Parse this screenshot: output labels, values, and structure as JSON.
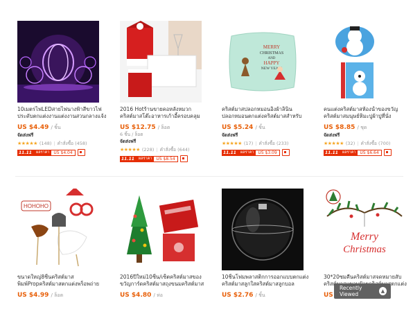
{
  "products": [
    {
      "title": "10เมตรไฟLEDสายไฟนางฟ้าสีขาวไฟประดับตกแต่งงานแต่งงานสวนกลางแจ้งคริสต์มาส สำหรับสวนไฟคริสต์มาสตกแต่งPTSP",
      "price": "US $4.49",
      "unit": "/ ชิ้น",
      "shipping": "จัดส่งฟรี",
      "reviews": "(148)",
      "orders": "คำสั่งซื้อ (458)",
      "promo_label": "ผลราคา",
      "promo_price": "US $4.04"
    },
    {
      "title": "2016 Hotร้านขายคอหลังหมวกคริสต์มาสโต๊ะอาหารเก้าอี้ครอบคลุมตกแต่งคริสต์มาส",
      "price": "US $12.75",
      "unit": "/ ล็อต",
      "sub": "6 ชิ้น / ล็อต",
      "shipping": "จัดส่งฟรี",
      "reviews": "(228)",
      "orders": "คำสั่งซื้อ (644)",
      "promo_label": "ผลราคา",
      "promo_price": "US $8.54"
    },
    {
      "title": "คริสต์มาสปลอกหมอนอิงผ้าลินินปลอกหมอนตกแต่งคริสต์มาสสำหรับโซฟา",
      "price": "US $5.24",
      "unit": "/ ชิ้น",
      "shipping": "จัดส่งฟรี",
      "reviews": "(17)",
      "orders": "คำสั่งซื้อ (233)",
      "promo_label": "ผลราคา",
      "promo_price": "US $3.09"
    },
    {
      "title": "คนแต่งคริสต์มาสห้องน้ำของขวัญคริสต์มาสมนุษย์หิมะปูผ้าปูที่นั่ง",
      "price": "US $8.85",
      "unit": "/ ชุด",
      "shipping": "จัดส่งฟรี",
      "reviews": "(32)",
      "orders": "คำสั่งซื้อ (700)",
      "promo_label": "ผลราคา",
      "promo_price": "US $6.64"
    },
    {
      "title": "ขนาดใหญ่8ชิ้นคริสต์มาสพิมพ์Propคริสต์มาสตกแต่งพร็อพถ่ายภาพสนุกสำหรับของขวัญ",
      "price": "US $4.99",
      "unit": "/ ล็อต"
    },
    {
      "title": "2016ปีใหม่10ชิ้น/เซ็ตคริสต์มาสของขวัญการ์ดคริสต์มาสถุงขนมคริสต์มาส",
      "price": "US $4.80",
      "unit": "/ ห่อ"
    },
    {
      "title": "10ชิ้นโฟมพลาสติกการออกแบบตกแต่งคริสต์มาสลูกใสคริสต์มาสลูกบอลพลาสติก",
      "price": "US $2.76",
      "unit": "/ ชิ้น"
    },
    {
      "title": "30*20ซมคืนคริสต์มาสจดหมายสับคริสต์มาสแขวนป้ายคริสต์มาสตกแต่งคริสต์มาส",
      "price": "US $",
      "unit": ""
    }
  ],
  "promo_tag": "11.11",
  "recently_viewed": "Recently Viewed",
  "image_texts": {
    "pillow_line1": "MERRY",
    "pillow_line2": "CHRISTMAS",
    "pillow_line3": "AND",
    "pillow_line4": "HAPPY",
    "pillow_line5": "NEW YEAR!",
    "props_text": "HOHOHO",
    "sign_line1": "Merry",
    "sign_line2": "Christmas"
  },
  "colors": {
    "price": "#e8600a",
    "promo": "#e62e04",
    "star": "#f5a623"
  }
}
